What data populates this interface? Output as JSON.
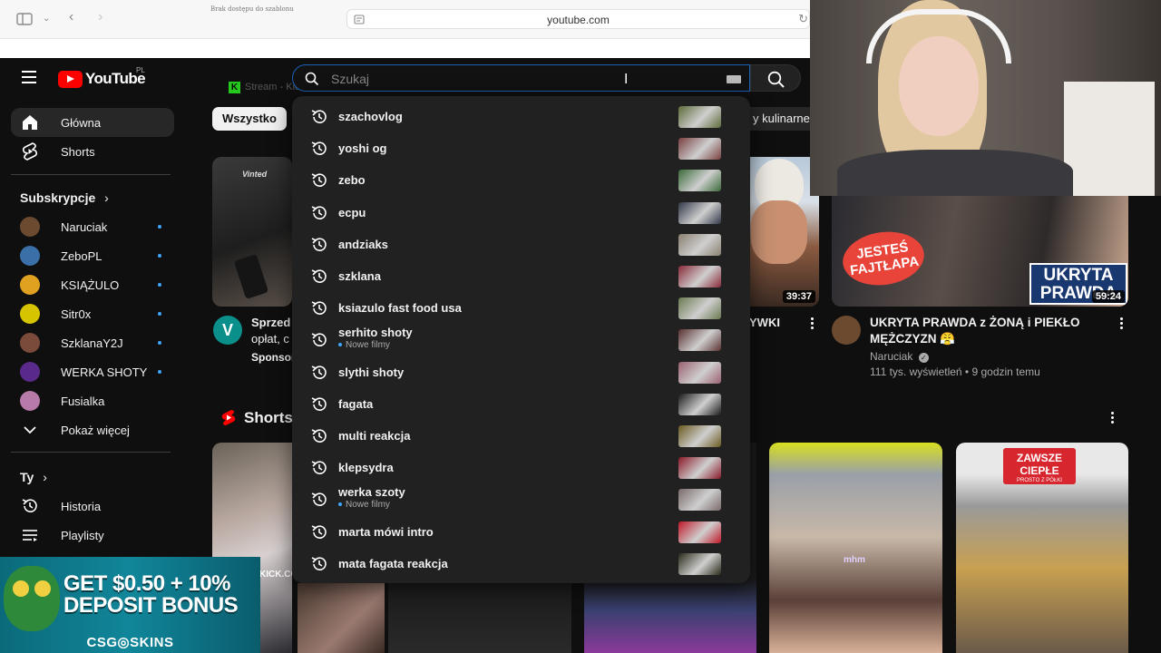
{
  "browser": {
    "url": "youtube.com",
    "tab_hint": "Brak dostępu do szablonu",
    "tab_title": "Stream - Kick Dashboard",
    "tab_logo": "K"
  },
  "header": {
    "logo_text": "YouTube",
    "country": "PL",
    "search_placeholder": "Szukaj"
  },
  "sidebar": {
    "main": [
      {
        "label": "Główna",
        "icon": "home-icon"
      },
      {
        "label": "Shorts",
        "icon": "shorts-icon"
      }
    ],
    "subs_heading": "Subskrypcje",
    "subs": [
      {
        "label": "Naruciak",
        "color": "#6b4a2f"
      },
      {
        "label": "ZeboPL",
        "color": "#3a6fa8"
      },
      {
        "label": "KSIĄŻULO",
        "color": "#e0a020"
      },
      {
        "label": "Sitr0x",
        "color": "#d6c400"
      },
      {
        "label": "SzklanaY2J",
        "color": "#7a4a3a"
      },
      {
        "label": "WERKA SHOTY",
        "color": "#5a2a8a"
      },
      {
        "label": "Fusialka",
        "color": "#b87aa8"
      }
    ],
    "show_more": "Pokaż więcej",
    "you_heading": "Ty",
    "you": [
      {
        "label": "Historia",
        "icon": "history-icon"
      },
      {
        "label": "Playlisty",
        "icon": "playlist-icon"
      }
    ]
  },
  "chips": {
    "all": "Wszystko",
    "cooking": "y kulinarne"
  },
  "videos": {
    "left": {
      "title": "Sprzed",
      "title2": "opłat, c",
      "sponsor": "Sponsor",
      "brand": "Vinted"
    },
    "mid": {
      "title": "YWKI",
      "duration": "39:37"
    },
    "right": {
      "title": "UKRYTA PRAWDA z ŻONĄ  i PIEKŁO MĘŻCZYZN 😤",
      "channel": "Naruciak",
      "meta": "111 tys. wyświetleń • 9 godzin temu",
      "duration": "59:24",
      "badge": "JESTEŚ FAJTŁAPA",
      "overlay": "UKRYTA PRAWDA"
    }
  },
  "shorts": {
    "heading": "Shorts",
    "card_text": "KICK.CO",
    "sign": "ZAWSZE CIEPŁE",
    "sign_sub": "PROSTO Z PÓŁKI",
    "watermark": "mhm"
  },
  "suggestions": [
    {
      "text": "szachovlog",
      "sub": "",
      "color": "#5d6b3a"
    },
    {
      "text": "yoshi og",
      "sub": "",
      "color": "#7a4040"
    },
    {
      "text": "zebo",
      "sub": "",
      "color": "#3a6a3a"
    },
    {
      "text": "ecpu",
      "sub": "",
      "color": "#303848"
    },
    {
      "text": "andziaks",
      "sub": "",
      "color": "#8a8070"
    },
    {
      "text": "szklana",
      "sub": "",
      "color": "#8a2a3a"
    },
    {
      "text": "ksiazulo fast food usa",
      "sub": "",
      "color": "#6a7a50"
    },
    {
      "text": "serhito shoty",
      "sub": "Nowe filmy",
      "color": "#5a3030"
    },
    {
      "text": "slythi shoty",
      "sub": "",
      "color": "#9a6070"
    },
    {
      "text": "fagata",
      "sub": "",
      "color": "#1a1a1a"
    },
    {
      "text": "multi reakcja",
      "sub": "",
      "color": "#6a5a20"
    },
    {
      "text": "klepsydra",
      "sub": "",
      "color": "#8a1a2a"
    },
    {
      "text": "werka szoty",
      "sub": "Nowe filmy",
      "color": "#7a6a6a"
    },
    {
      "text": "marta mówi intro",
      "sub": "",
      "color": "#c01828"
    },
    {
      "text": "mata fagata reakcja",
      "sub": "",
      "color": "#2a2a1a"
    }
  ],
  "promo": {
    "headline_1": "GET $0.50 + 10%",
    "headline_2": "DEPOSIT BONUS",
    "brand": "CSG◎SKINS"
  },
  "colors": {
    "bg": "#0f0f0f",
    "accent_red": "#ff0000",
    "search_border": "#1c62b9",
    "dropdown": "#212121",
    "kick_green": "#25c91d",
    "new_dot": "#3ea6ff"
  }
}
